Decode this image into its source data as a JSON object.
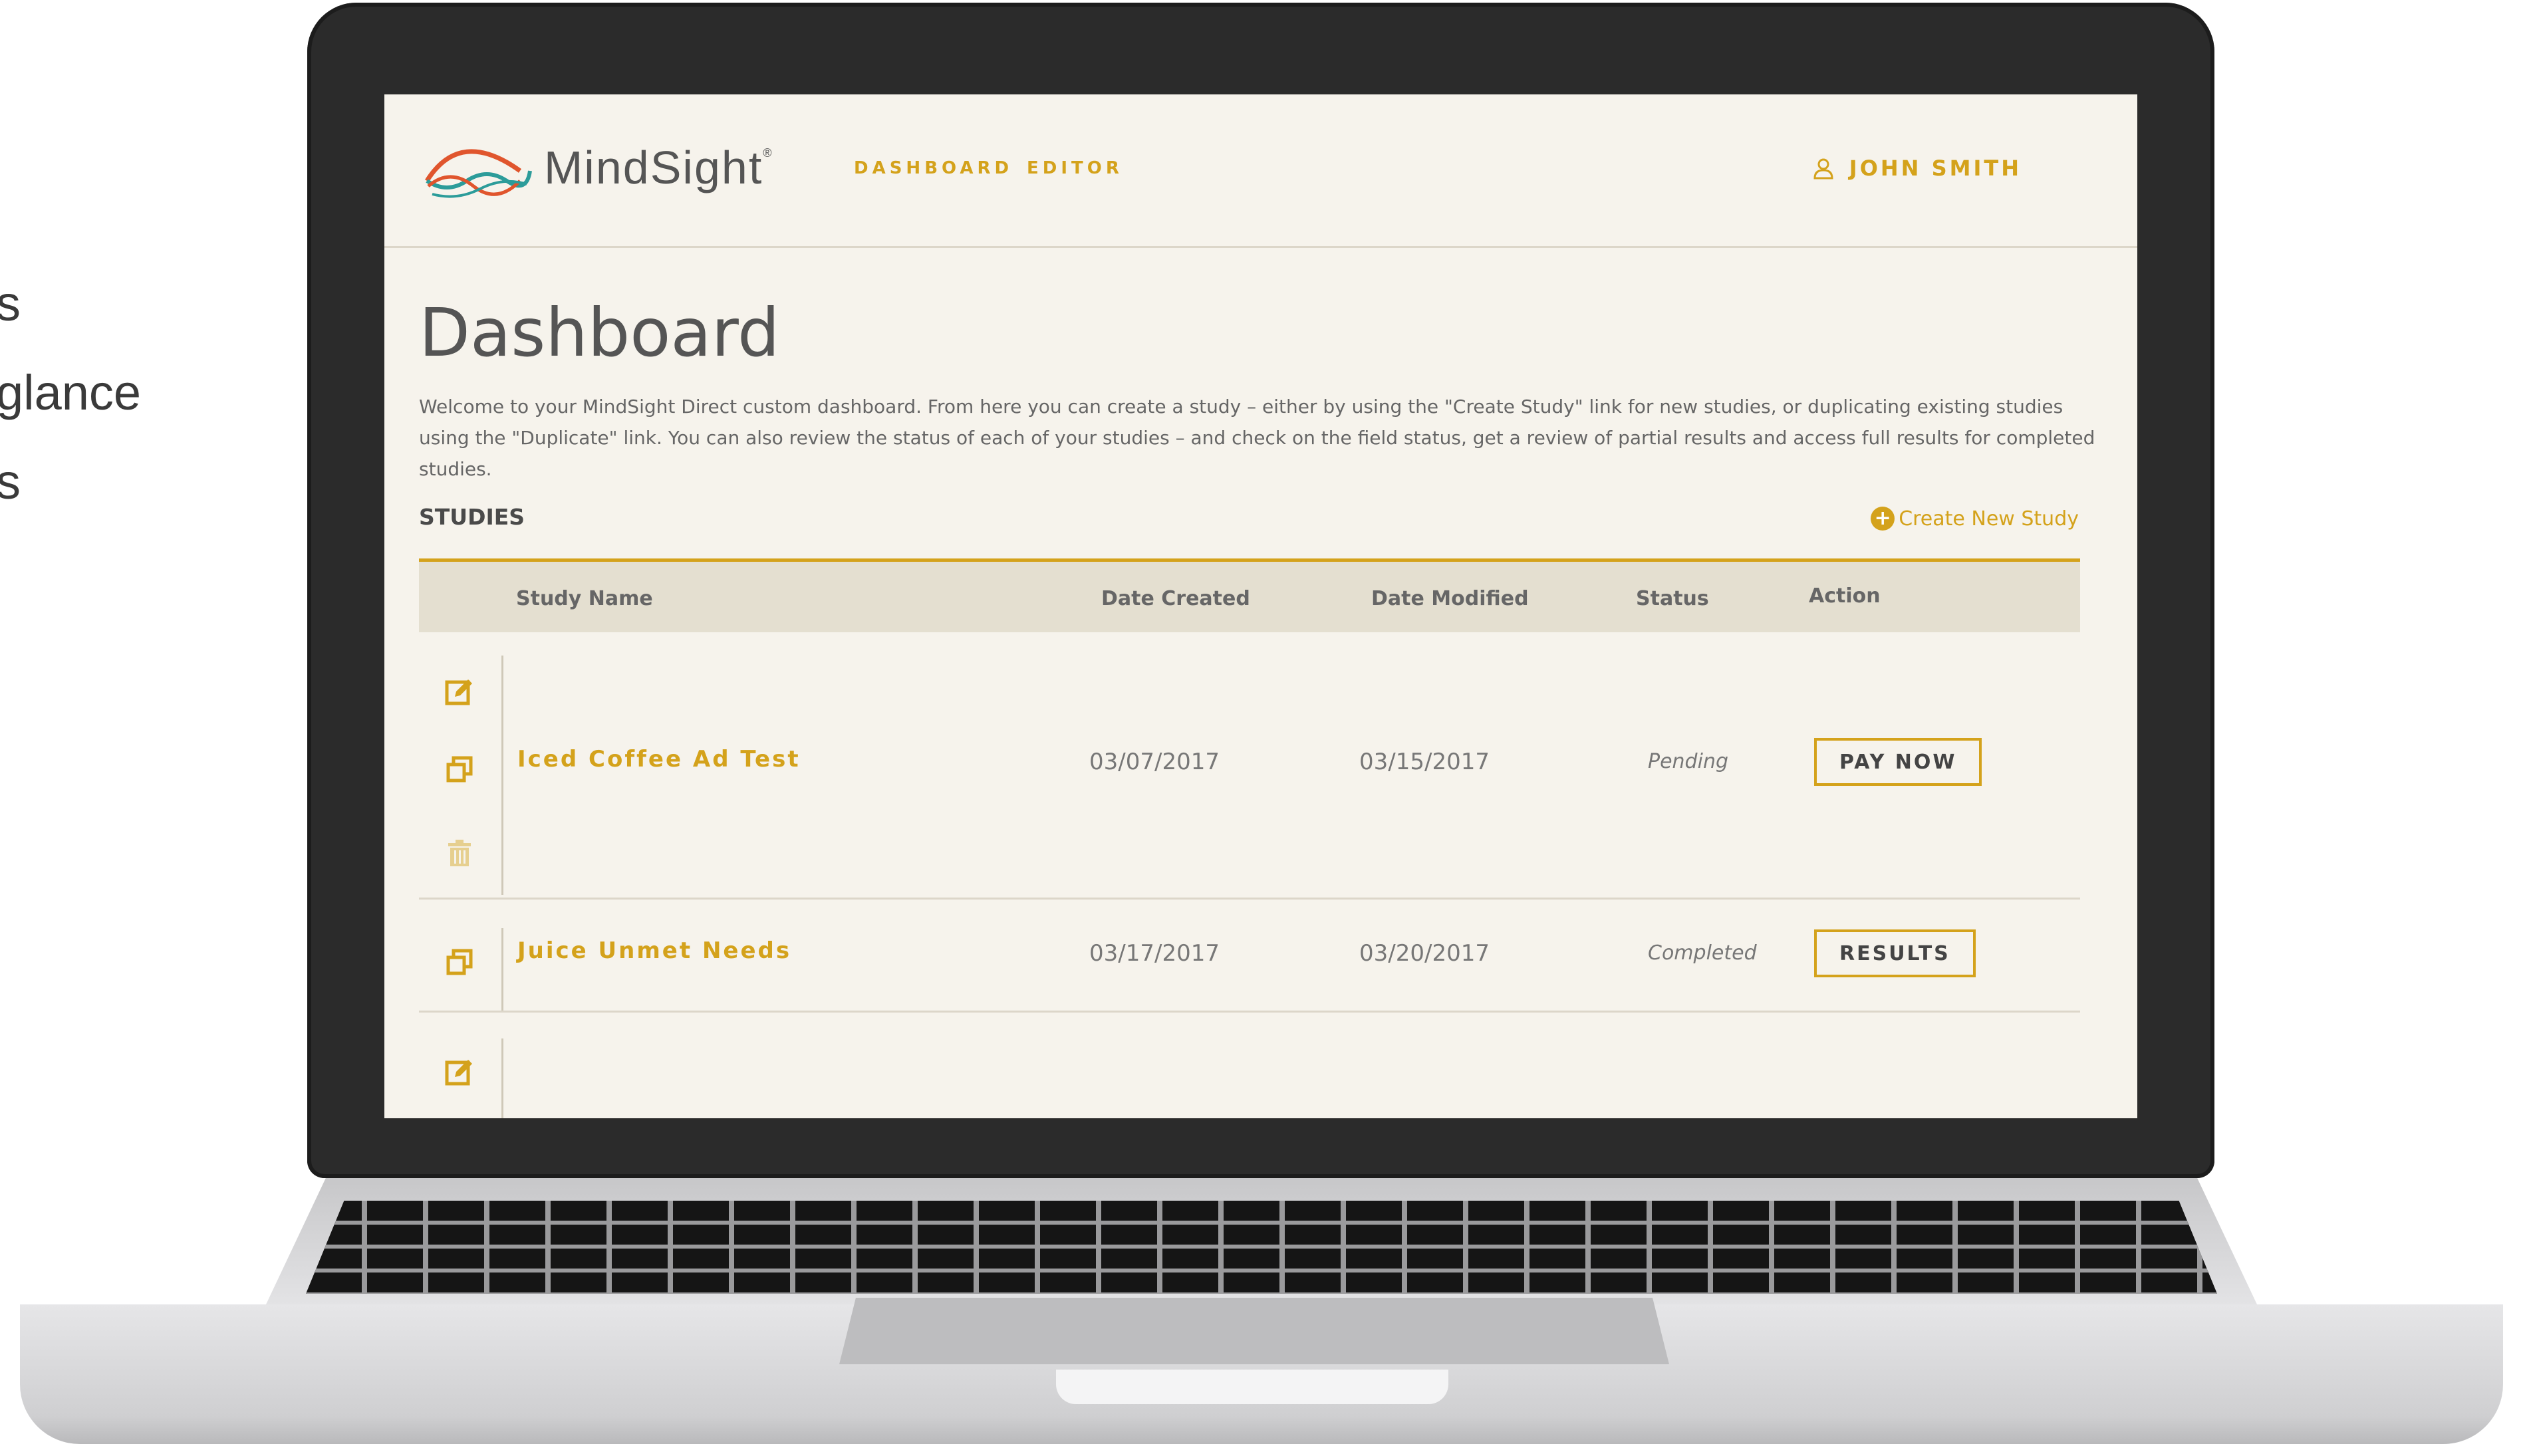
{
  "background_fragments": [
    "s",
    "glance",
    "s"
  ],
  "header": {
    "brand": "MindSight",
    "brand_mark": "®",
    "nav": [
      "DASHBOARD",
      "EDITOR"
    ],
    "user_name": "JOHN SMITH"
  },
  "page": {
    "title": "Dashboard",
    "intro": "Welcome to your MindSight Direct custom dashboard. From here you can create a study – either by using the \"Create Study\" link for new studies, or duplicating existing studies using the \"Duplicate\" link. You can also review the status of each of your studies – and check on the field status, get a review of partial results and access full results for completed studies.",
    "studies_label": "STUDIES",
    "create_label": "Create New Study"
  },
  "table": {
    "columns": [
      "Study Name",
      "Date Created",
      "Date Modified",
      "Status",
      "Action"
    ],
    "rows": [
      {
        "name": "Iced Coffee Ad Test",
        "created": "03/07/2017",
        "modified": "03/15/2017",
        "status": "Pending",
        "action": "PAY NOW",
        "icons": [
          "edit-icon",
          "duplicate-icon",
          "trash-icon"
        ]
      },
      {
        "name": "Juice Unmet Needs",
        "created": "03/17/2017",
        "modified": "03/20/2017",
        "status": "Completed",
        "action": "RESULTS",
        "icons": [
          "duplicate-icon"
        ]
      },
      {
        "icons": [
          "edit-icon"
        ]
      }
    ]
  },
  "colors": {
    "accent": "#d4a21b",
    "screen_bg": "#f6f3ec",
    "header_row_bg": "#e4dfd0"
  }
}
